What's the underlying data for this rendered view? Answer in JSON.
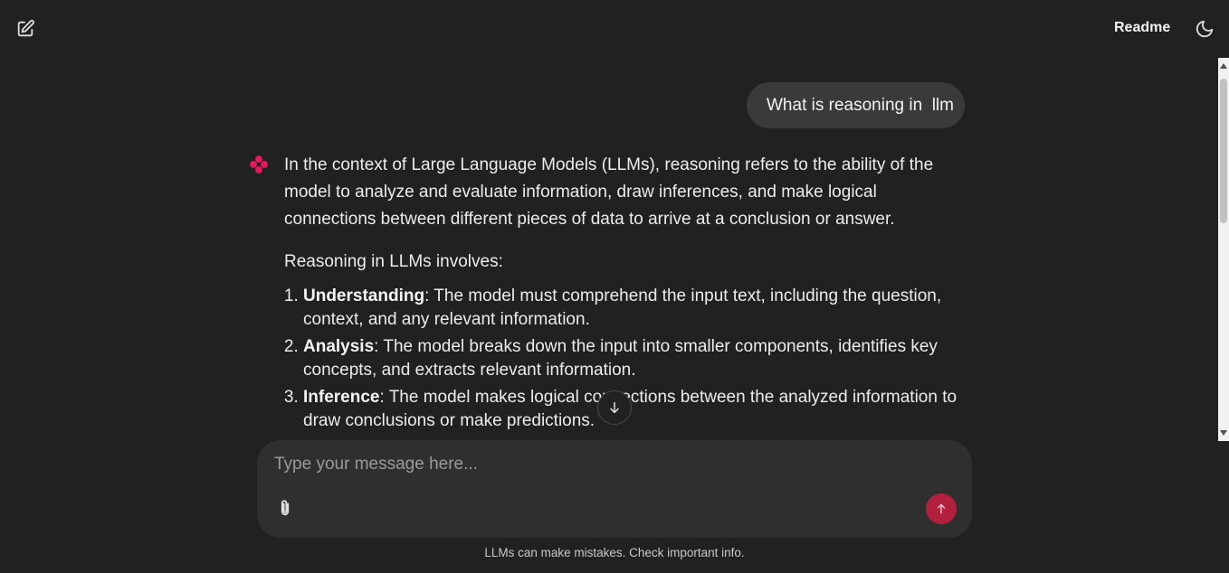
{
  "header": {
    "readme_label": "Readme",
    "new_chat_icon": "edit-icon",
    "theme_icon": "moon-icon"
  },
  "conversation": {
    "user_message": "What is reasoning in  llm",
    "assistant": {
      "intro": "In the context of Large Language Models (LLMs), reasoning refers to the ability of the model to analyze and evaluate information, draw inferences, and make logical connections between different pieces of data to arrive at a conclusion or answer.",
      "list_heading": "Reasoning in LLMs involves:",
      "items": [
        {
          "term": "Understanding",
          "text": ": The model must comprehend the input text, including the question, context, and any relevant information."
        },
        {
          "term": "Analysis",
          "text": ": The model breaks down the input into smaller components, identifies key concepts, and extracts relevant information."
        },
        {
          "term": "Inference",
          "text": ": The model makes logical connections between the analyzed information to draw conclusions or make predictions."
        }
      ]
    }
  },
  "composer": {
    "placeholder": "Type your message here...",
    "value": "",
    "attach_icon": "paperclip-icon",
    "send_icon": "arrow-up-icon"
  },
  "disclaimer": "LLMs can make mistakes. Check important info.",
  "colors": {
    "background": "#212121",
    "user_bubble": "#3a3a3a",
    "composer": "#2f2f2f",
    "accent": "#b3203f",
    "avatar": "#e8185f"
  }
}
